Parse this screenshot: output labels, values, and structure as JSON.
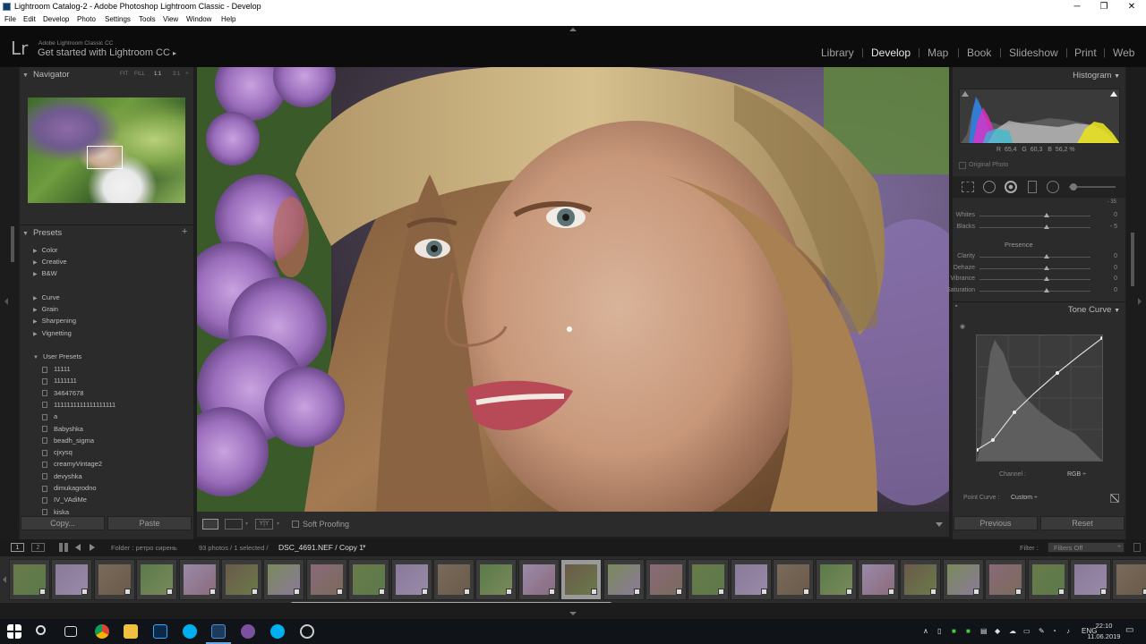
{
  "window": {
    "title": "Lightroom Catalog-2 - Adobe Photoshop Lightroom Classic - Develop",
    "minimize": "─",
    "maximize": "❐",
    "close": "✕"
  },
  "menu": [
    "File",
    "Edit",
    "Develop",
    "Photo",
    "Settings",
    "Tools",
    "View",
    "Window",
    "Help"
  ],
  "identity": {
    "logo": "Lr",
    "small": "Adobe Lightroom Classic CC",
    "big": "Get started with Lightroom CC",
    "arrow": "▸"
  },
  "modules": [
    "Library",
    "Develop",
    "Map",
    "Book",
    "Slideshow",
    "Print",
    "Web"
  ],
  "navigator": {
    "title": "Navigator",
    "zoom": [
      "FIT",
      "FILL",
      "1:1",
      "3:1"
    ],
    "more": "÷"
  },
  "presets": {
    "title": "Presets",
    "add": "+",
    "groups": [
      "Color",
      "Creative",
      "B&W",
      "Curve",
      "Grain",
      "Sharpening",
      "Vignetting"
    ],
    "user_title": "User Presets",
    "user": [
      "11111",
      "1111111",
      "34647678",
      "1111111111111111111",
      "a",
      "Babyshka",
      "beadh_sigma",
      "cjxysq",
      "creamyVintage2",
      "devyshka",
      "dimukagrodno",
      "IV_VAdiMe",
      "kiska"
    ]
  },
  "left_buttons": {
    "copy": "Copy...",
    "paste": "Paste"
  },
  "toolbar": {
    "soft_proofing": "Soft Proofing",
    "yy": "Y|Y"
  },
  "histogram": {
    "title": "Histogram",
    "r_label": "R",
    "r": "65,4",
    "g_label": "G",
    "g": "60,3",
    "b_label": "B",
    "b": "56,2",
    "pct": "%",
    "original": "Original Photo"
  },
  "basic": {
    "sliders": [
      {
        "label": "Whites",
        "value": "0"
      },
      {
        "label": "Blacks",
        "value": "- 5"
      }
    ],
    "presence_title": "Presence",
    "presence": [
      {
        "label": "Clarity",
        "value": "0"
      },
      {
        "label": "Dehaze",
        "value": "0"
      },
      {
        "label": "Vibrance",
        "value": "0"
      },
      {
        "label": "Saturation",
        "value": "0"
      }
    ],
    "shadows_partial": "- 35"
  },
  "tone_curve": {
    "title": "Tone Curve",
    "channel_label": "Channel :",
    "channel": "RGB ÷",
    "point_curve_label": "Point Curve :",
    "point_curve": "Custom ÷"
  },
  "right_buttons": {
    "previous": "Previous",
    "reset": "Reset"
  },
  "filmbar": {
    "view1": "1",
    "view2": "2",
    "folder": "Folder : ретро сирень",
    "count": "93 photos / 1 selected /",
    "file": "DSC_4691.NEF / Copy 1",
    "file_arrow": "▾",
    "filter_label": "Filter :",
    "filter": "Filters Off",
    "filter_arrow": "÷"
  },
  "taskbar": {
    "lang": "ENG",
    "time": "22:10",
    "date": "11.06.2019"
  },
  "colors": {
    "bg": "#1e1e1e",
    "panel": "#2b2b2b",
    "active_module": "#e8e8e8"
  }
}
